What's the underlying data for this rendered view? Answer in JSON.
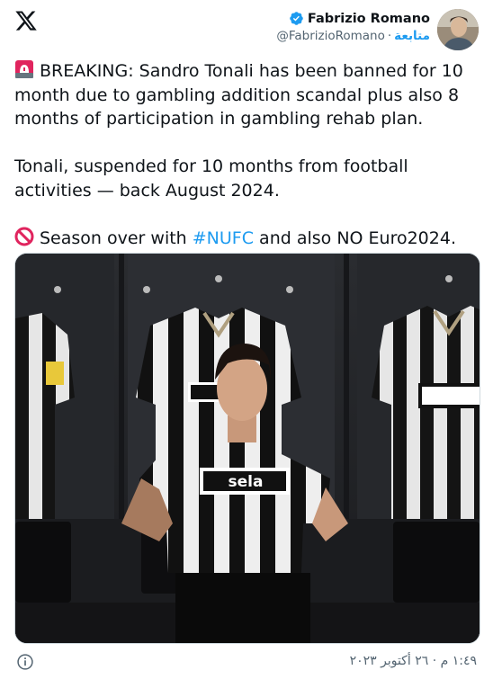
{
  "author": {
    "name": "Fabrizio Romano",
    "handle": "@FabrizioRomano",
    "follow_label": "متابعة"
  },
  "tweet": {
    "line1": "BREAKING: Sandro Tonali has been banned for 10 month due to gambling addition scandal plus also 8 months of participation in gambling rehab plan.",
    "line2": "Tonali, suspended for 10 months from football activities — back August 2024.",
    "line3_pre": "Season over with ",
    "line3_hashtag": "#NUFC",
    "line3_post": " and also NO Euro2024."
  },
  "media": {
    "sponsor": "sela"
  },
  "footer": {
    "timestamp": "١:٤٩ م · ٢٦ أكتوبر ٢٠٢٣"
  },
  "colors": {
    "accent": "#1d9bf0",
    "text": "#0f1419",
    "muted": "#536471"
  },
  "icons": [
    "x-logo-icon",
    "verified-badge-icon",
    "siren-icon",
    "no-entry-icon",
    "info-icon"
  ]
}
